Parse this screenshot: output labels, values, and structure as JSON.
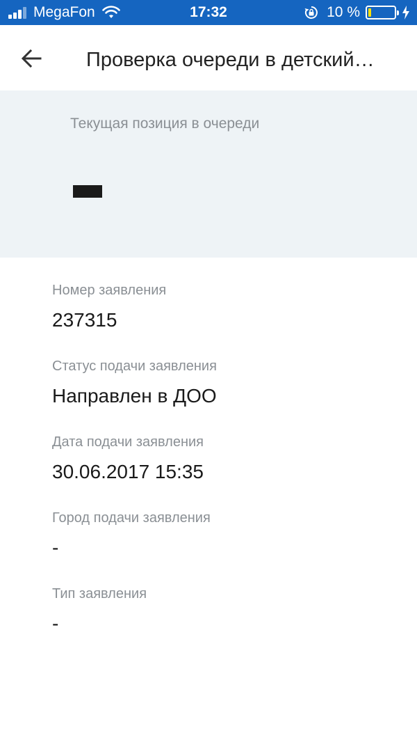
{
  "status_bar": {
    "carrier": "MegaFon",
    "time": "17:32",
    "battery_percent": "10 %",
    "battery_level": 0.1,
    "battery_color": "#ffe000",
    "background_color": "#1565c0",
    "icons": [
      "signal-icon",
      "wifi-icon",
      "orientation-lock-icon",
      "battery-icon",
      "charging-icon"
    ]
  },
  "app_bar": {
    "back_icon": "arrow-left-icon",
    "title": "Проверка очереди в детский…"
  },
  "queue_position": {
    "label": "Текущая позиция в очереди",
    "value_redacted": true
  },
  "details": [
    {
      "label": "Номер заявления",
      "value": "237315"
    },
    {
      "label": "Статус подачи заявления",
      "value": "Направлен в ДОО"
    },
    {
      "label": "Дата подачи заявления",
      "value": "30.06.2017 15:35"
    },
    {
      "label": "Город подачи заявления",
      "value": "-"
    },
    {
      "label": "Тип заявления",
      "value": "-"
    }
  ]
}
